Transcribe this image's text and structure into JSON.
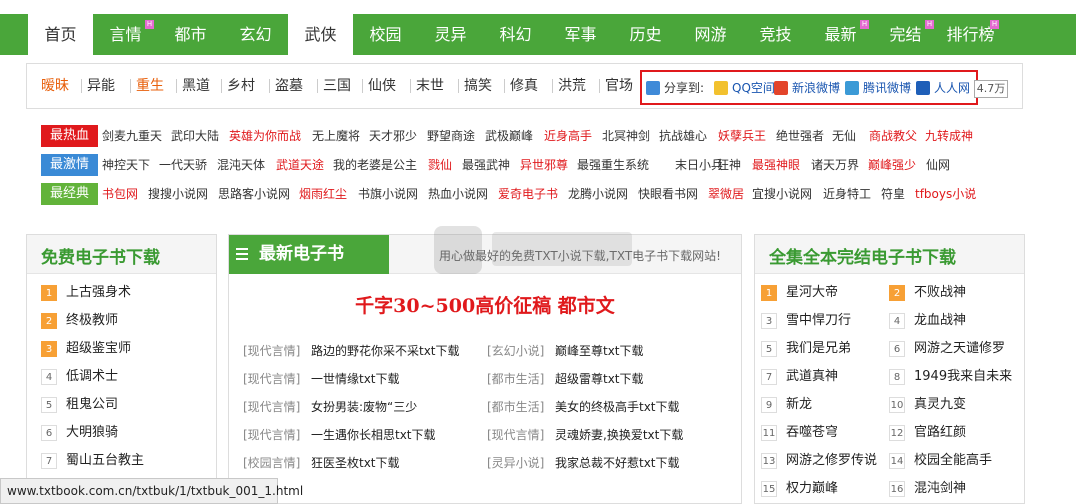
{
  "nav": {
    "items": [
      {
        "label": "首页",
        "active": true,
        "badge": ""
      },
      {
        "label": "言情",
        "active": false,
        "badge": "H"
      },
      {
        "label": "都市",
        "active": false,
        "badge": ""
      },
      {
        "label": "玄幻",
        "active": false,
        "badge": ""
      },
      {
        "label": "武侠",
        "active": true,
        "badge": ""
      },
      {
        "label": "校园",
        "active": false,
        "badge": ""
      },
      {
        "label": "灵异",
        "active": false,
        "badge": ""
      },
      {
        "label": "科幻",
        "active": false,
        "badge": ""
      },
      {
        "label": "军事",
        "active": false,
        "badge": ""
      },
      {
        "label": "历史",
        "active": false,
        "badge": ""
      },
      {
        "label": "网游",
        "active": false,
        "badge": ""
      },
      {
        "label": "竞技",
        "active": false,
        "badge": ""
      },
      {
        "label": "最新",
        "active": false,
        "badge": "H"
      },
      {
        "label": "完结",
        "active": false,
        "badge": "H"
      },
      {
        "label": "排行榜",
        "active": false,
        "badge": "H"
      }
    ]
  },
  "tags": [
    "暧昧",
    "异能",
    "重生",
    "黑道",
    "乡村",
    "盗墓",
    "三国",
    "仙侠",
    "末世",
    "搞笑",
    "修真",
    "洪荒",
    "官场"
  ],
  "share": {
    "prefix": "分享到:",
    "targets": [
      "QQ空间",
      "新浪微博",
      "腾讯微博",
      "人人网"
    ],
    "count": "4.7万"
  },
  "hot": [
    {
      "label": "最热血",
      "color": "#e0191c",
      "links": [
        {
          "t": "剑麦九重天",
          "red": false
        },
        {
          "t": "武印大陆",
          "red": false
        },
        {
          "t": "英雄为你而战",
          "red": true
        },
        {
          "t": "无上魔将",
          "red": false
        },
        {
          "t": "天才邪少",
          "red": false
        },
        {
          "t": "野望商途",
          "red": false
        },
        {
          "t": "武极巅峰",
          "red": false
        },
        {
          "t": "近身高手",
          "red": true
        },
        {
          "t": "北冥神剑",
          "red": false
        },
        {
          "t": "抗战雄心",
          "red": false
        },
        {
          "t": "妖孽兵王",
          "red": true
        },
        {
          "t": "绝世强者",
          "red": false
        },
        {
          "t": "无仙",
          "red": false
        },
        {
          "t": "商战教父",
          "red": true
        },
        {
          "t": "九转成神",
          "red": true
        }
      ]
    },
    {
      "label": "最激情",
      "color": "#3a8ad6",
      "links": [
        {
          "t": "神控天下",
          "red": false
        },
        {
          "t": "一代天骄",
          "red": false
        },
        {
          "t": "混沌天体",
          "red": false
        },
        {
          "t": "武道天途",
          "red": true
        },
        {
          "t": "我的老婆是公主",
          "red": false
        },
        {
          "t": "戮仙",
          "red": true
        },
        {
          "t": "最强武神",
          "red": false
        },
        {
          "t": "异世邪尊",
          "red": true
        },
        {
          "t": "最强重生系统",
          "red": false
        },
        {
          "t": "末日小兵",
          "red": false
        },
        {
          "t": "狂神",
          "red": false
        },
        {
          "t": "最强神眼",
          "red": true
        },
        {
          "t": "诸天万界",
          "red": false
        },
        {
          "t": "巅峰强少",
          "red": true
        },
        {
          "t": "仙网",
          "red": false
        }
      ]
    },
    {
      "label": "最经典",
      "color": "#62b33a",
      "links": [
        {
          "t": "书包网",
          "red": true
        },
        {
          "t": "搜搜小说网",
          "red": false
        },
        {
          "t": "思路客小说网",
          "red": false
        },
        {
          "t": "烟雨红尘",
          "red": true
        },
        {
          "t": "书旗小说网",
          "red": false
        },
        {
          "t": "热血小说网",
          "red": false
        },
        {
          "t": "爱奇电子书",
          "red": true
        },
        {
          "t": "龙腾小说网",
          "red": false
        },
        {
          "t": "快眼看书网",
          "red": false
        },
        {
          "t": "翠微居",
          "red": true
        },
        {
          "t": "宜搜小说网",
          "red": false
        },
        {
          "t": "近身特工",
          "red": false
        },
        {
          "t": "符皇",
          "red": false
        },
        {
          "t": "tfboys小说",
          "red": true
        }
      ]
    }
  ],
  "left_panel": {
    "title": "免费电子书下载",
    "items": [
      {
        "n": "1",
        "t": "上古强身术",
        "top": true
      },
      {
        "n": "2",
        "t": "终极教师",
        "top": true
      },
      {
        "n": "3",
        "t": "超级鉴宝师",
        "top": true
      },
      {
        "n": "4",
        "t": "低调术士",
        "top": false
      },
      {
        "n": "5",
        "t": "租鬼公司",
        "top": false
      },
      {
        "n": "6",
        "t": "大明狼骑",
        "top": false
      },
      {
        "n": "7",
        "t": "蜀山五台教主",
        "top": false
      }
    ]
  },
  "mid_panel": {
    "title": "最新电子书",
    "slogan": "用心做最好的免费TXT小说下载,TXT电子书下载网站!",
    "banner": "千字30~500高价征稿 都市文",
    "books": [
      [
        {
          "c": "[现代言情]",
          "t": "路边的野花你采不采txt下载"
        },
        {
          "c": "[玄幻小说]",
          "t": "巅峰至尊txt下载"
        }
      ],
      [
        {
          "c": "[现代言情]",
          "t": "一世情缘txt下载"
        },
        {
          "c": "[都市生活]",
          "t": "超级雷尊txt下载"
        }
      ],
      [
        {
          "c": "[现代言情]",
          "t": "女扮男装:废物“三少"
        },
        {
          "c": "[都市生活]",
          "t": "美女的终极高手txt下载"
        }
      ],
      [
        {
          "c": "[现代言情]",
          "t": "一生遇你长相思txt下载"
        },
        {
          "c": "[现代言情]",
          "t": "灵魂娇妻,换换爱txt下载"
        }
      ],
      [
        {
          "c": "[校园言情]",
          "t": "狂医圣枚txt下载"
        },
        {
          "c": "[灵异小说]",
          "t": "我家总裁不好惹txt下载"
        }
      ]
    ]
  },
  "right_panel": {
    "title": "全集全本完结电子书下载",
    "col1": [
      {
        "n": "1",
        "t": "星河大帝",
        "top": true
      },
      {
        "n": "3",
        "t": "雪中悍刀行",
        "top": false
      },
      {
        "n": "5",
        "t": "我们是兄弟",
        "top": false
      },
      {
        "n": "7",
        "t": "武道真神",
        "top": false
      },
      {
        "n": "9",
        "t": "新龙",
        "top": false
      },
      {
        "n": "11",
        "t": "吞噬苍穹",
        "top": false
      },
      {
        "n": "13",
        "t": "网游之修罗传说",
        "top": false
      },
      {
        "n": "15",
        "t": "权力巅峰",
        "top": false
      }
    ],
    "col2": [
      {
        "n": "2",
        "t": "不败战神",
        "top": true
      },
      {
        "n": "4",
        "t": "龙血战神",
        "top": false
      },
      {
        "n": "6",
        "t": "网游之天谴修罗",
        "top": false
      },
      {
        "n": "8",
        "t": "1949我来自未来",
        "top": false
      },
      {
        "n": "10",
        "t": "真灵九变",
        "top": false
      },
      {
        "n": "12",
        "t": "官路红颜",
        "top": false
      },
      {
        "n": "14",
        "t": "校园全能高手",
        "top": false
      },
      {
        "n": "16",
        "t": "混沌剑神",
        "top": false
      }
    ]
  },
  "status": {
    "url": "www.txtbook.com.cn/txtbuk/1/txtbuk_001_1.html"
  },
  "colors": {
    "nav_green": "#4aa63a",
    "accent_red": "#e0191c",
    "rank_orange": "#f7a035"
  }
}
